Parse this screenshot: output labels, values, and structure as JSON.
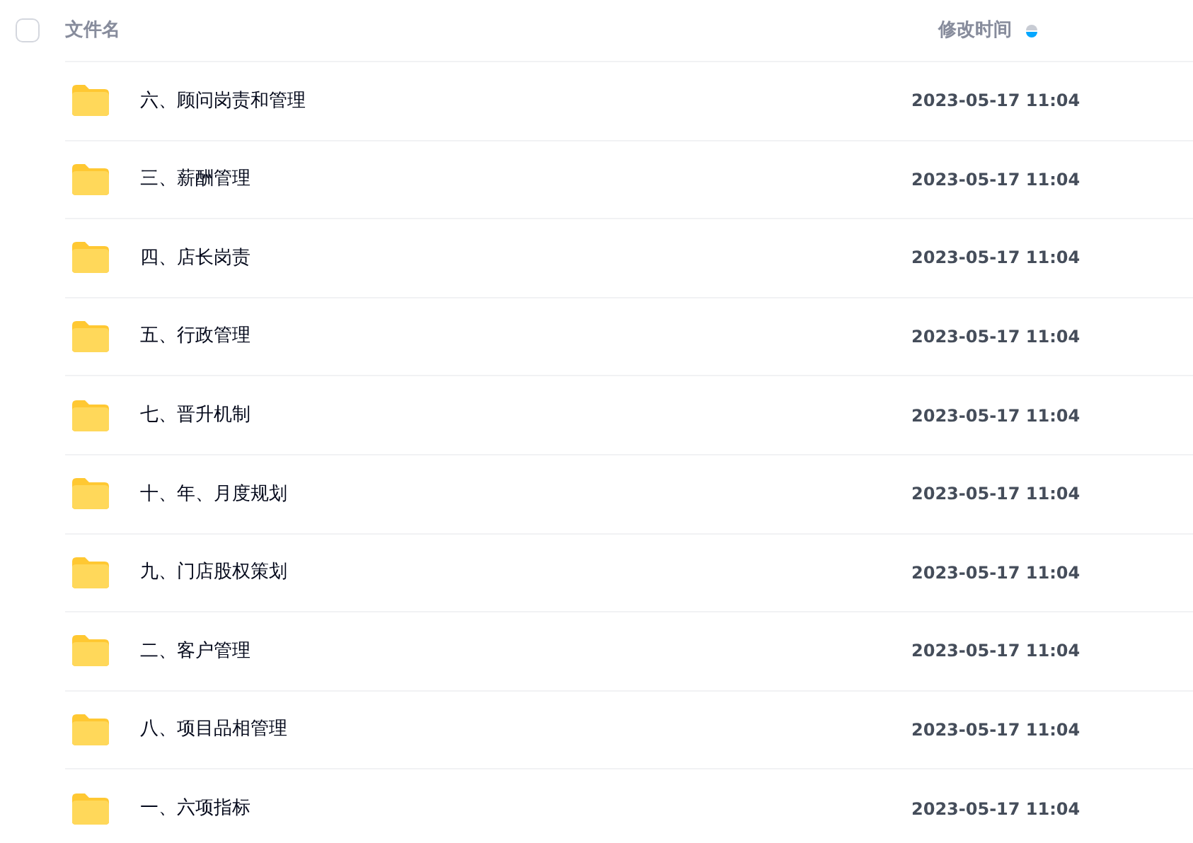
{
  "header": {
    "select_all": {
      "checked": false
    },
    "columns": [
      {
        "label": "文件名"
      },
      {
        "label": "修改时间",
        "sort_descending": true
      }
    ]
  },
  "rows": [
    {
      "name": "六、顾问岗责和管理",
      "modified": "2023-05-17 11:04"
    },
    {
      "name": "三、薪酬管理",
      "modified": "2023-05-17 11:04"
    },
    {
      "name": "四、店长岗责",
      "modified": "2023-05-17 11:04"
    },
    {
      "name": "五、行政管理",
      "modified": "2023-05-17 11:04"
    },
    {
      "name": "七、晋升机制",
      "modified": "2023-05-17 11:04"
    },
    {
      "name": "十、年、月度规划",
      "modified": "2023-05-17 11:04"
    },
    {
      "name": "九、门店股权策划",
      "modified": "2023-05-17 11:04"
    },
    {
      "name": "二、客户管理",
      "modified": "2023-05-17 11:04"
    },
    {
      "name": "八、项目品相管理",
      "modified": "2023-05-17 11:04"
    },
    {
      "name": "一、六项指标",
      "modified": "2023-05-17 11:04"
    }
  ]
}
